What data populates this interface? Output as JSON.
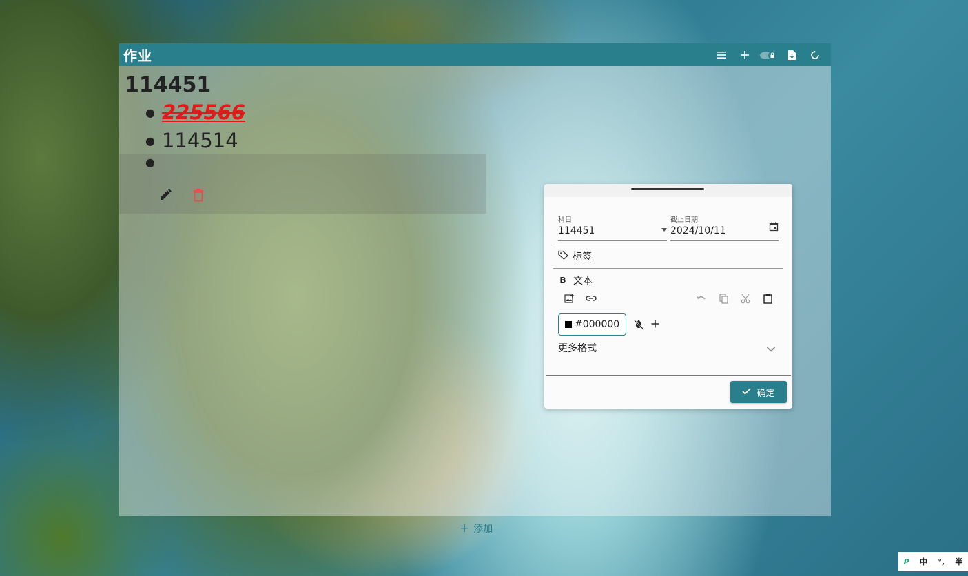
{
  "app": {
    "title": "作业",
    "toolbar": [
      "menu-icon",
      "add-icon",
      "lock-toggle-icon",
      "export-file-icon",
      "refresh-icon"
    ]
  },
  "list": {
    "subject": "114451",
    "items": [
      {
        "text": "225566",
        "color": "#e21a1a",
        "bold": true,
        "italic": true,
        "strikethrough": true,
        "underline": true
      },
      {
        "text": "114514"
      },
      {
        "text": ""
      }
    ],
    "row_actions": [
      "edit-icon",
      "delete-icon"
    ],
    "add_label": "添加"
  },
  "editor": {
    "subject_label": "科目",
    "subject_value": "114451",
    "date_label": "截止日期",
    "date_value": "2024/10/11",
    "tags_label": "标签",
    "text_label": "文本",
    "color_value": "#000000",
    "more_format_label": "更多格式",
    "confirm_label": "确定"
  },
  "ime": {
    "logo": "P",
    "lang": "中",
    "punct": "°,",
    "width": "半"
  },
  "colors": {
    "accent": "#2a7f8c",
    "delete": "#e05050"
  }
}
